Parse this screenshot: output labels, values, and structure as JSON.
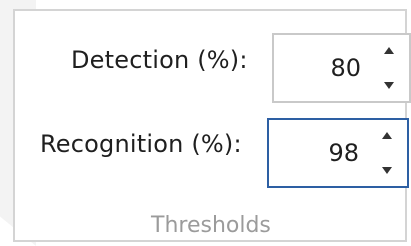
{
  "group": {
    "title": "Thresholds",
    "fields": [
      {
        "label": "Detection (%):",
        "value": "80",
        "up_icon": "triangle-up-icon",
        "down_icon": "triangle-down-icon"
      },
      {
        "label": "Recognition (%):",
        "value": "98",
        "up_icon": "triangle-up-icon",
        "down_icon": "triangle-down-icon"
      }
    ]
  },
  "colors": {
    "panel_border": "#d4d4d4",
    "focus_border": "#2d5fa3",
    "group_title": "#9b9b9b",
    "text": "#1f1f1f"
  }
}
